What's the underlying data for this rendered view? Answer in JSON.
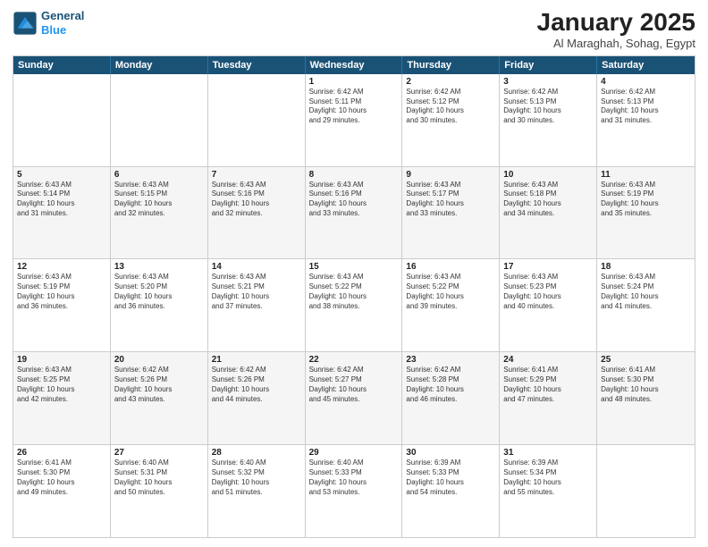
{
  "header": {
    "logo_line1": "General",
    "logo_line2": "Blue",
    "month_title": "January 2025",
    "location": "Al Maraghah, Sohag, Egypt"
  },
  "weekdays": [
    "Sunday",
    "Monday",
    "Tuesday",
    "Wednesday",
    "Thursday",
    "Friday",
    "Saturday"
  ],
  "rows": [
    [
      {
        "day": "",
        "text": ""
      },
      {
        "day": "",
        "text": ""
      },
      {
        "day": "",
        "text": ""
      },
      {
        "day": "1",
        "text": "Sunrise: 6:42 AM\nSunset: 5:11 PM\nDaylight: 10 hours\nand 29 minutes."
      },
      {
        "day": "2",
        "text": "Sunrise: 6:42 AM\nSunset: 5:12 PM\nDaylight: 10 hours\nand 30 minutes."
      },
      {
        "day": "3",
        "text": "Sunrise: 6:42 AM\nSunset: 5:13 PM\nDaylight: 10 hours\nand 30 minutes."
      },
      {
        "day": "4",
        "text": "Sunrise: 6:42 AM\nSunset: 5:13 PM\nDaylight: 10 hours\nand 31 minutes."
      }
    ],
    [
      {
        "day": "5",
        "text": "Sunrise: 6:43 AM\nSunset: 5:14 PM\nDaylight: 10 hours\nand 31 minutes."
      },
      {
        "day": "6",
        "text": "Sunrise: 6:43 AM\nSunset: 5:15 PM\nDaylight: 10 hours\nand 32 minutes."
      },
      {
        "day": "7",
        "text": "Sunrise: 6:43 AM\nSunset: 5:16 PM\nDaylight: 10 hours\nand 32 minutes."
      },
      {
        "day": "8",
        "text": "Sunrise: 6:43 AM\nSunset: 5:16 PM\nDaylight: 10 hours\nand 33 minutes."
      },
      {
        "day": "9",
        "text": "Sunrise: 6:43 AM\nSunset: 5:17 PM\nDaylight: 10 hours\nand 33 minutes."
      },
      {
        "day": "10",
        "text": "Sunrise: 6:43 AM\nSunset: 5:18 PM\nDaylight: 10 hours\nand 34 minutes."
      },
      {
        "day": "11",
        "text": "Sunrise: 6:43 AM\nSunset: 5:19 PM\nDaylight: 10 hours\nand 35 minutes."
      }
    ],
    [
      {
        "day": "12",
        "text": "Sunrise: 6:43 AM\nSunset: 5:19 PM\nDaylight: 10 hours\nand 36 minutes."
      },
      {
        "day": "13",
        "text": "Sunrise: 6:43 AM\nSunset: 5:20 PM\nDaylight: 10 hours\nand 36 minutes."
      },
      {
        "day": "14",
        "text": "Sunrise: 6:43 AM\nSunset: 5:21 PM\nDaylight: 10 hours\nand 37 minutes."
      },
      {
        "day": "15",
        "text": "Sunrise: 6:43 AM\nSunset: 5:22 PM\nDaylight: 10 hours\nand 38 minutes."
      },
      {
        "day": "16",
        "text": "Sunrise: 6:43 AM\nSunset: 5:22 PM\nDaylight: 10 hours\nand 39 minutes."
      },
      {
        "day": "17",
        "text": "Sunrise: 6:43 AM\nSunset: 5:23 PM\nDaylight: 10 hours\nand 40 minutes."
      },
      {
        "day": "18",
        "text": "Sunrise: 6:43 AM\nSunset: 5:24 PM\nDaylight: 10 hours\nand 41 minutes."
      }
    ],
    [
      {
        "day": "19",
        "text": "Sunrise: 6:43 AM\nSunset: 5:25 PM\nDaylight: 10 hours\nand 42 minutes."
      },
      {
        "day": "20",
        "text": "Sunrise: 6:42 AM\nSunset: 5:26 PM\nDaylight: 10 hours\nand 43 minutes."
      },
      {
        "day": "21",
        "text": "Sunrise: 6:42 AM\nSunset: 5:26 PM\nDaylight: 10 hours\nand 44 minutes."
      },
      {
        "day": "22",
        "text": "Sunrise: 6:42 AM\nSunset: 5:27 PM\nDaylight: 10 hours\nand 45 minutes."
      },
      {
        "day": "23",
        "text": "Sunrise: 6:42 AM\nSunset: 5:28 PM\nDaylight: 10 hours\nand 46 minutes."
      },
      {
        "day": "24",
        "text": "Sunrise: 6:41 AM\nSunset: 5:29 PM\nDaylight: 10 hours\nand 47 minutes."
      },
      {
        "day": "25",
        "text": "Sunrise: 6:41 AM\nSunset: 5:30 PM\nDaylight: 10 hours\nand 48 minutes."
      }
    ],
    [
      {
        "day": "26",
        "text": "Sunrise: 6:41 AM\nSunset: 5:30 PM\nDaylight: 10 hours\nand 49 minutes."
      },
      {
        "day": "27",
        "text": "Sunrise: 6:40 AM\nSunset: 5:31 PM\nDaylight: 10 hours\nand 50 minutes."
      },
      {
        "day": "28",
        "text": "Sunrise: 6:40 AM\nSunset: 5:32 PM\nDaylight: 10 hours\nand 51 minutes."
      },
      {
        "day": "29",
        "text": "Sunrise: 6:40 AM\nSunset: 5:33 PM\nDaylight: 10 hours\nand 53 minutes."
      },
      {
        "day": "30",
        "text": "Sunrise: 6:39 AM\nSunset: 5:33 PM\nDaylight: 10 hours\nand 54 minutes."
      },
      {
        "day": "31",
        "text": "Sunrise: 6:39 AM\nSunset: 5:34 PM\nDaylight: 10 hours\nand 55 minutes."
      },
      {
        "day": "",
        "text": ""
      }
    ]
  ]
}
